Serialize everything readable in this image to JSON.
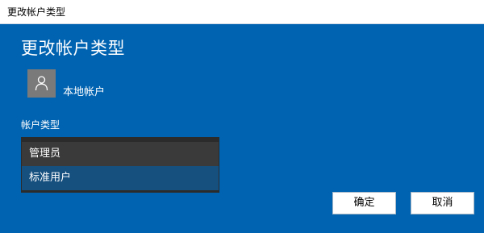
{
  "window": {
    "title": "更改帐户类型"
  },
  "header": {
    "title": "更改帐户类型"
  },
  "account": {
    "name": "本地帐户",
    "avatar_icon": "user-silhouette-icon"
  },
  "account_type": {
    "label": "帐户类型",
    "options": [
      {
        "label": "管理员",
        "state": "hover"
      },
      {
        "label": "标准用户",
        "state": "selected"
      }
    ]
  },
  "buttons": {
    "ok_label": "确定",
    "cancel_label": "取消"
  },
  "colors": {
    "background": "#0063b1",
    "dropdown_bg": "#2b2b2b",
    "selected_option": "#16507f",
    "hover_option": "#3a3a3a",
    "avatar_bg": "#7a7a7a"
  }
}
